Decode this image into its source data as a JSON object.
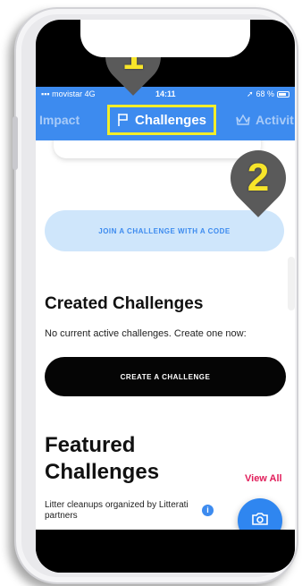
{
  "status_bar": {
    "carrier": "movistar",
    "network": "4G",
    "time": "14:11",
    "battery": "68 %"
  },
  "tabs": [
    {
      "label": "Impact",
      "active": false
    },
    {
      "label": "Challenges",
      "active": true
    },
    {
      "label": "Activit",
      "active": false
    }
  ],
  "join_button": {
    "label": "JOIN A CHALLENGE WITH A CODE"
  },
  "created": {
    "title": "Created Challenges",
    "empty_text": "No current active challenges. Create one now:",
    "button_label": "CREATE A CHALLENGE"
  },
  "featured": {
    "title": "Featured Challenges",
    "view_all": "View All",
    "subtitle": "Litter cleanups organized by Litterati partners",
    "info_glyph": "i"
  },
  "callouts": [
    "1",
    "2"
  ],
  "colors": {
    "accent": "#3d8bef",
    "highlight": "#f2ee2a",
    "view_all": "#e11d5a",
    "callout_bg": "#5a5a5a",
    "callout_text": "#f7e52a"
  },
  "icons": [
    "flag-icon",
    "crown-icon",
    "info-icon",
    "camera-icon"
  ]
}
